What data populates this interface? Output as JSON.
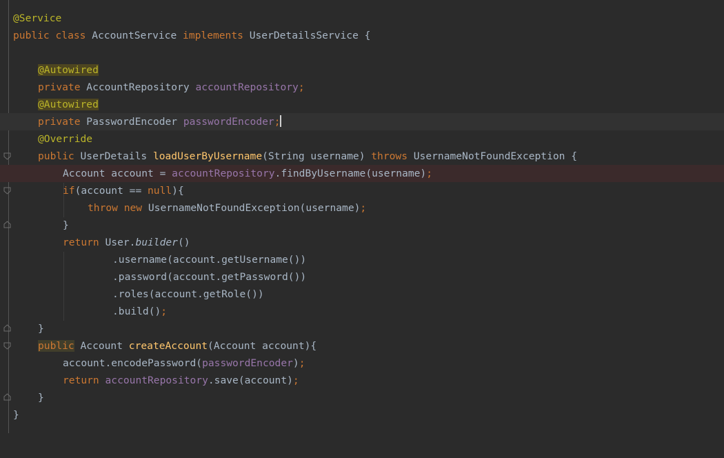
{
  "editor": {
    "language": "java",
    "colors": {
      "background": "#2b2b2b",
      "keyword": "#cc7832",
      "annotation": "#bbb529",
      "field": "#9876aa",
      "method_declaration": "#ffc66d",
      "plain": "#a9b7c6",
      "current_line": "#323232",
      "breakpoint_line": "#3b2a2b"
    },
    "lines": [
      {
        "tokens": [
          "@Service"
        ]
      },
      {
        "tokens": [
          "public",
          " ",
          "class",
          " AccountService ",
          "implements",
          " UserDetailsService {"
        ]
      },
      {
        "tokens": [
          ""
        ]
      },
      {
        "tokens": [
          "@Autowired"
        ]
      },
      {
        "tokens": [
          "private",
          " AccountRepository ",
          "accountRepository",
          ";"
        ]
      },
      {
        "tokens": [
          "@Autowired"
        ]
      },
      {
        "tokens": [
          "private",
          " PasswordEncoder ",
          "passwordEncoder",
          ";"
        ]
      },
      {
        "tokens": [
          "@Override"
        ]
      },
      {
        "tokens": [
          "public",
          " UserDetails ",
          "loadUserByUsername",
          "(String username) ",
          "throws",
          " UsernameNotFoundException {"
        ]
      },
      {
        "tokens": [
          "Account account = ",
          "accountRepository",
          ".findByUsername(username)",
          ";"
        ]
      },
      {
        "tokens": [
          "if",
          "(account == ",
          "null",
          "){"
        ]
      },
      {
        "tokens": [
          "throw",
          " ",
          "new",
          " UsernameNotFoundException(username)",
          ";"
        ]
      },
      {
        "tokens": [
          "}"
        ]
      },
      {
        "tokens": [
          "return",
          " User.",
          "builder",
          "()"
        ]
      },
      {
        "tokens": [
          ".username(account.getUsername())"
        ]
      },
      {
        "tokens": [
          ".password(account.getPassword())"
        ]
      },
      {
        "tokens": [
          ".roles(account.getRole())"
        ]
      },
      {
        "tokens": [
          ".build()",
          ";"
        ]
      },
      {
        "tokens": [
          "}"
        ]
      },
      {
        "tokens": [
          "public",
          " Account ",
          "createAccount",
          "(Account account){"
        ]
      },
      {
        "tokens": [
          "account.encodePassword(",
          "passwordEncoder",
          ")",
          ";"
        ]
      },
      {
        "tokens": [
          "return",
          " ",
          "accountRepository",
          ".save(account)",
          ";"
        ]
      },
      {
        "tokens": [
          "}"
        ]
      },
      {
        "tokens": [
          "}"
        ]
      }
    ]
  }
}
